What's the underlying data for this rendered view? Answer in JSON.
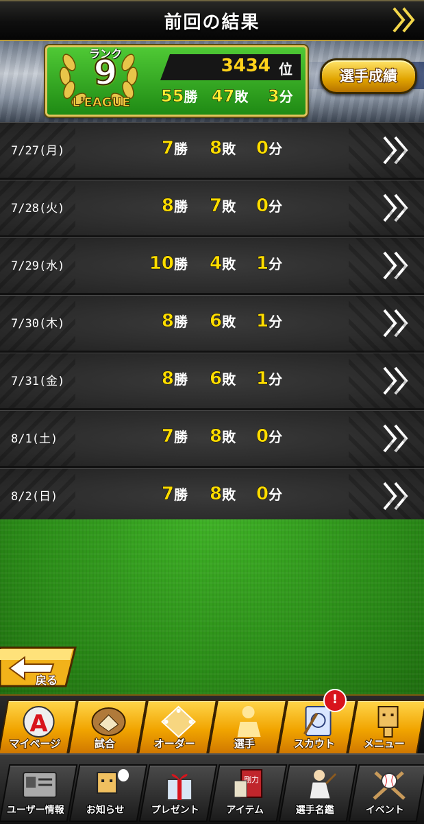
{
  "header": {
    "title": "前回の結果"
  },
  "summary": {
    "rank_label": "ランク",
    "rank": "9",
    "league": "L'EAGUE",
    "position": "3434",
    "position_unit": "位",
    "wins": "55",
    "losses": "47",
    "draws": "3",
    "win_unit": "勝",
    "loss_unit": "敗",
    "draw_unit": "分",
    "stats_button_label": "選手成績"
  },
  "days": [
    {
      "date": "7/27(月)",
      "wins": "7",
      "losses": "8",
      "draws": "0"
    },
    {
      "date": "7/28(火)",
      "wins": "8",
      "losses": "7",
      "draws": "0"
    },
    {
      "date": "7/29(水)",
      "wins": "10",
      "losses": "4",
      "draws": "1"
    },
    {
      "date": "7/30(木)",
      "wins": "8",
      "losses": "6",
      "draws": "1"
    },
    {
      "date": "7/31(金)",
      "wins": "8",
      "losses": "6",
      "draws": "1"
    },
    {
      "date": "8/1(土)",
      "wins": "7",
      "losses": "8",
      "draws": "0"
    },
    {
      "date": "8/2(日)",
      "wins": "7",
      "losses": "8",
      "draws": "0"
    }
  ],
  "back_button": {
    "label": "戻る"
  },
  "menu_primary": [
    {
      "label": "マイページ",
      "icon": "a-badge-icon"
    },
    {
      "label": "試合",
      "icon": "glove-icon"
    },
    {
      "label": "オーダー",
      "icon": "diamond-field-icon"
    },
    {
      "label": "選手",
      "icon": "player-icon"
    },
    {
      "label": "スカウト",
      "icon": "scout-card-icon",
      "badge": "!"
    },
    {
      "label": "メニュー",
      "icon": "box-mascot-icon"
    }
  ],
  "menu_secondary": [
    {
      "label": "ユーザー情報",
      "icon": "user-card-icon"
    },
    {
      "label": "お知らせ",
      "icon": "mascot-speech-icon"
    },
    {
      "label": "プレゼント",
      "icon": "gift-icon"
    },
    {
      "label": "アイテム",
      "icon": "item-book-icon",
      "icon_text": "剛力"
    },
    {
      "label": "選手名鑑",
      "icon": "player-directory-icon"
    },
    {
      "label": "イベント",
      "icon": "ball-bats-icon"
    }
  ],
  "colors": {
    "accent_yellow": "#ffdd00",
    "rank_green": "#2fa81c",
    "button_gold": "#f1a400",
    "badge_red": "#d8141c"
  }
}
